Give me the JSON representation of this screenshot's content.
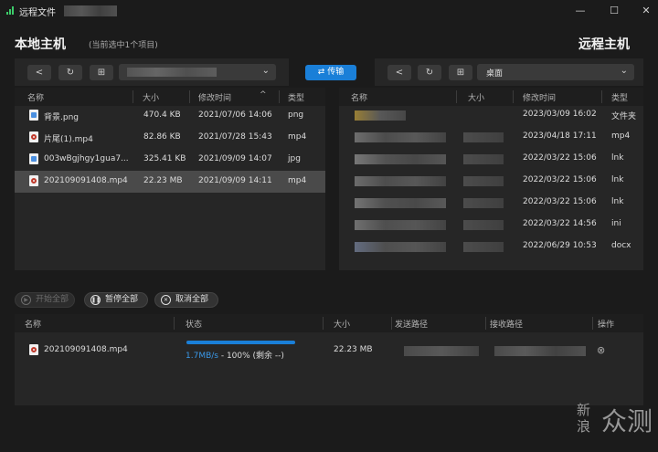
{
  "window": {
    "title": "远程文件",
    "controls": {
      "minimize": "—",
      "maximize": "☐",
      "close": "✕"
    }
  },
  "local": {
    "heading": "本地主机",
    "subheading": "(当前选中1个项目)",
    "columns": [
      "名称",
      "大小",
      "修改时间",
      "类型"
    ],
    "sort_indicator": "^",
    "files": [
      {
        "name": "背景.png",
        "size": "470.4 KB",
        "modified": "2021/07/06 14:06",
        "type": "png",
        "icon": "image-file-icon"
      },
      {
        "name": "片尾(1).mp4",
        "size": "82.86 KB",
        "modified": "2021/07/28 15:43",
        "type": "mp4",
        "icon": "video-file-icon"
      },
      {
        "name": "003wBgjhgy1gua7...",
        "size": "325.41 KB",
        "modified": "2021/09/09 14:07",
        "type": "jpg",
        "icon": "image-file-icon"
      },
      {
        "name": "202109091408.mp4",
        "size": "22.23 MB",
        "modified": "2021/09/09 14:11",
        "type": "mp4",
        "icon": "video-file-icon",
        "selected": true
      }
    ]
  },
  "remote": {
    "heading": "远程主机",
    "path": "桌面",
    "columns": [
      "名称",
      "大小",
      "修改时间",
      "类型"
    ],
    "files": [
      {
        "modified": "2023/03/09 16:02",
        "type": "文件夹"
      },
      {
        "modified": "2023/04/18 17:11",
        "type": "mp4"
      },
      {
        "modified": "2022/03/22 15:06",
        "type": "lnk"
      },
      {
        "modified": "2022/03/22 15:06",
        "type": "lnk"
      },
      {
        "modified": "2022/03/22 15:06",
        "type": "lnk"
      },
      {
        "modified": "2022/03/22 14:56",
        "type": "ini"
      },
      {
        "modified": "2022/06/29 10:53",
        "type": "docx"
      }
    ]
  },
  "transfer_button": "传输",
  "actions": {
    "start_all": "开始全部",
    "pause_all": "暂停全部",
    "cancel_all": "取消全部"
  },
  "queue": {
    "columns": [
      "名称",
      "状态",
      "大小",
      "发送路径",
      "接收路径",
      "操作"
    ],
    "items": [
      {
        "name": "202109091408.mp4",
        "speed": "1.7MB/s",
        "status_rest": " - 100% (剩余 --)",
        "progress": 1.0,
        "size": "22.23 MB"
      }
    ]
  },
  "watermark": {
    "a": "新",
    "b": "浪",
    "c": "众测"
  },
  "colors": {
    "accent": "#1a7fd8",
    "panel": "#262626",
    "background": "#1b1b1b",
    "selected_row": "#4a4a4a"
  }
}
